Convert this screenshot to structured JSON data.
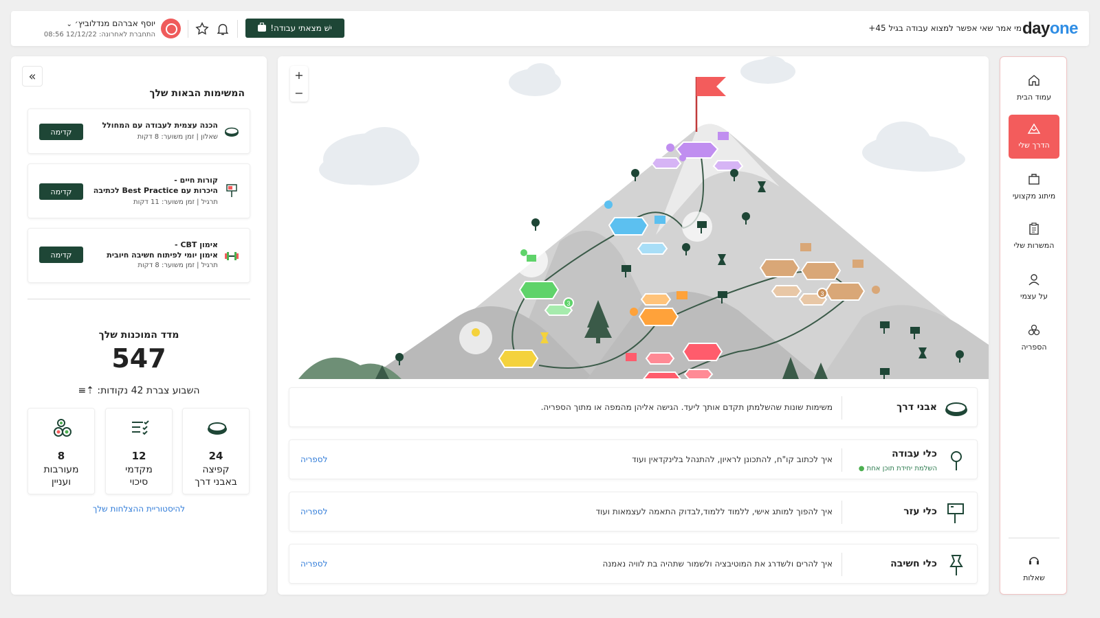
{
  "header": {
    "logo_day": "day",
    "logo_one": "one",
    "tagline": "מי אמר שאי אפשר למצוא עבודה בגיל 45+",
    "user_name": "יוסף אברהם מנדלוביץ׳",
    "last_login": "התחברת לאחרונה: 12/12/22 08:56",
    "found_job_label": "ישׁ מצאתי עבודה!",
    "icons": [
      "bell-icon",
      "star-icon",
      "avatar",
      "chevron-down-icon"
    ]
  },
  "left_panel": {
    "title": "המשימות הבאות שלך",
    "tasks": [
      {
        "title": "הכנה עצמית לעבודה עם המחולל",
        "type": "שאלון",
        "duration": "זמן משוער: 8 דקות",
        "button": "קדימה",
        "icon": "milestone-icon"
      },
      {
        "title_line1": "קורות חיים -",
        "title_line2": "היכרות עם Best Practice לכתיבה",
        "type": "תרגיל",
        "duration": "זמן משוער: 11 דקות",
        "button": "קדימה",
        "icon": "sign-icon"
      },
      {
        "title_line1": "אימון CBT -",
        "title_line2": "אימון יומי לפיתוח חשיבה חיובית",
        "type": "תרגיל",
        "duration": "זמן משוער: 8 דקות",
        "button": "קדימה",
        "icon": "dumbbell-icon"
      }
    ],
    "readiness_title": "מדד המוכנות שלך",
    "readiness_value": "547",
    "week_text": "השבוע צברת 42 נקודות:",
    "stats": [
      {
        "value": "24",
        "label_line1": "קפיצה",
        "label_line2": "באבני דרך",
        "icon": "milestone-icon"
      },
      {
        "value": "12",
        "label_line1": "מקדמי",
        "label_line2": "סיכוי",
        "icon": "checklist-icon"
      },
      {
        "value": "8",
        "label_line1": "מעורבות",
        "label_line2": "ועניין",
        "icon": "engagement-icon"
      }
    ],
    "history_link": "להיסטוריית ההצלחות שלך"
  },
  "map": {
    "zoom_in": "+",
    "zoom_out": "−",
    "badge_1": "3",
    "badge_2": "3"
  },
  "legend": [
    {
      "title": "אבני דרך",
      "subtitle": "",
      "desc": "משימות שונות שהשלמתן תקדם אותך ליעד. הגישה אליהן מהמפה או מתוך הספריה.",
      "link": "",
      "icon": "milestone-icon"
    },
    {
      "title": "כלי עבודה",
      "subtitle": "השלמת יחידת תוכן אחת",
      "desc": "איך לכתוב קו\"ח, להתכונן לראיון, להתנהל בלינקדאין ועוד",
      "link": "לספריה",
      "icon": "pin-icon"
    },
    {
      "title": "כלי עזר",
      "subtitle": "",
      "desc": "איך להפוך למותג אישי, ללמוד ללמוד,לבדוק התאמה לעצמאות ועוד",
      "link": "לספריה",
      "icon": "sign-icon"
    },
    {
      "title": "כלי חשיבה",
      "subtitle": "",
      "desc": "איך להרים ולשדרג את המוטיבציה ולשמור שתהיה בת לוויה נאמנה",
      "link": "לספריה",
      "icon": "pushpin-icon"
    }
  ],
  "nav": {
    "items": [
      {
        "label": "עמוד הבית",
        "icon": "home-icon"
      },
      {
        "label": "הדרך שלי",
        "icon": "mountain-icon"
      },
      {
        "label": "מיתוג מקצועי",
        "icon": "briefcase-icon"
      },
      {
        "label": "המשרות שלי",
        "icon": "clipboard-icon"
      },
      {
        "label": "על עצמי",
        "icon": "user-icon"
      },
      {
        "label": "הספריה",
        "icon": "library-icon"
      }
    ],
    "questions_label": "שאלות",
    "questions_icon": "support-icon",
    "active_index": 1
  },
  "colors": {
    "brand_green": "#1e4636",
    "accent_red": "#f35c5c",
    "link_blue": "#2f7bd8"
  }
}
